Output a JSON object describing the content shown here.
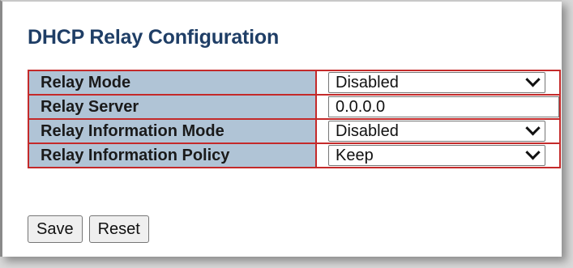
{
  "page": {
    "title": "DHCP Relay Configuration"
  },
  "rows": [
    {
      "label": "Relay Mode",
      "type": "select",
      "value": "Disabled"
    },
    {
      "label": "Relay Server",
      "type": "text",
      "value": "0.0.0.0"
    },
    {
      "label": "Relay Information Mode",
      "type": "select",
      "value": "Disabled"
    },
    {
      "label": "Relay Information Policy",
      "type": "select",
      "value": "Keep"
    }
  ],
  "buttons": {
    "save_label": "Save",
    "reset_label": "Reset"
  },
  "colors": {
    "title": "#1f3e66",
    "label_bg": "#b0c4d6",
    "border": "#c42a2a"
  }
}
